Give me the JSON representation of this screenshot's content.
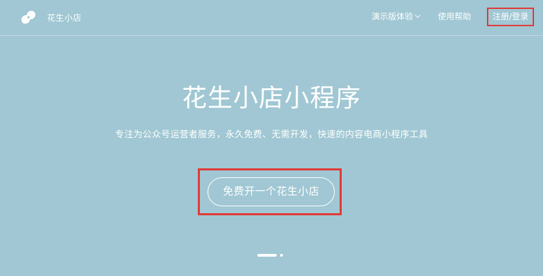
{
  "header": {
    "brand_name": "花生小店",
    "logo_icon": "peanut-logo-icon",
    "nav": {
      "demo_label": "演示版体验",
      "help_label": "使用帮助",
      "login_label": "注册/登录"
    }
  },
  "hero": {
    "title": "花生小店小程序",
    "subtitle": "专注为公众号运营者服务，永久免费、无需开发，快速的内容电商小程序工具",
    "cta_label": "免费开一个花生小店"
  },
  "carousel": {
    "slide_count": 2,
    "active_index": 0
  },
  "colors": {
    "background": "#a0c7d3",
    "highlight": "#e03a36",
    "text": "#ffffff"
  }
}
